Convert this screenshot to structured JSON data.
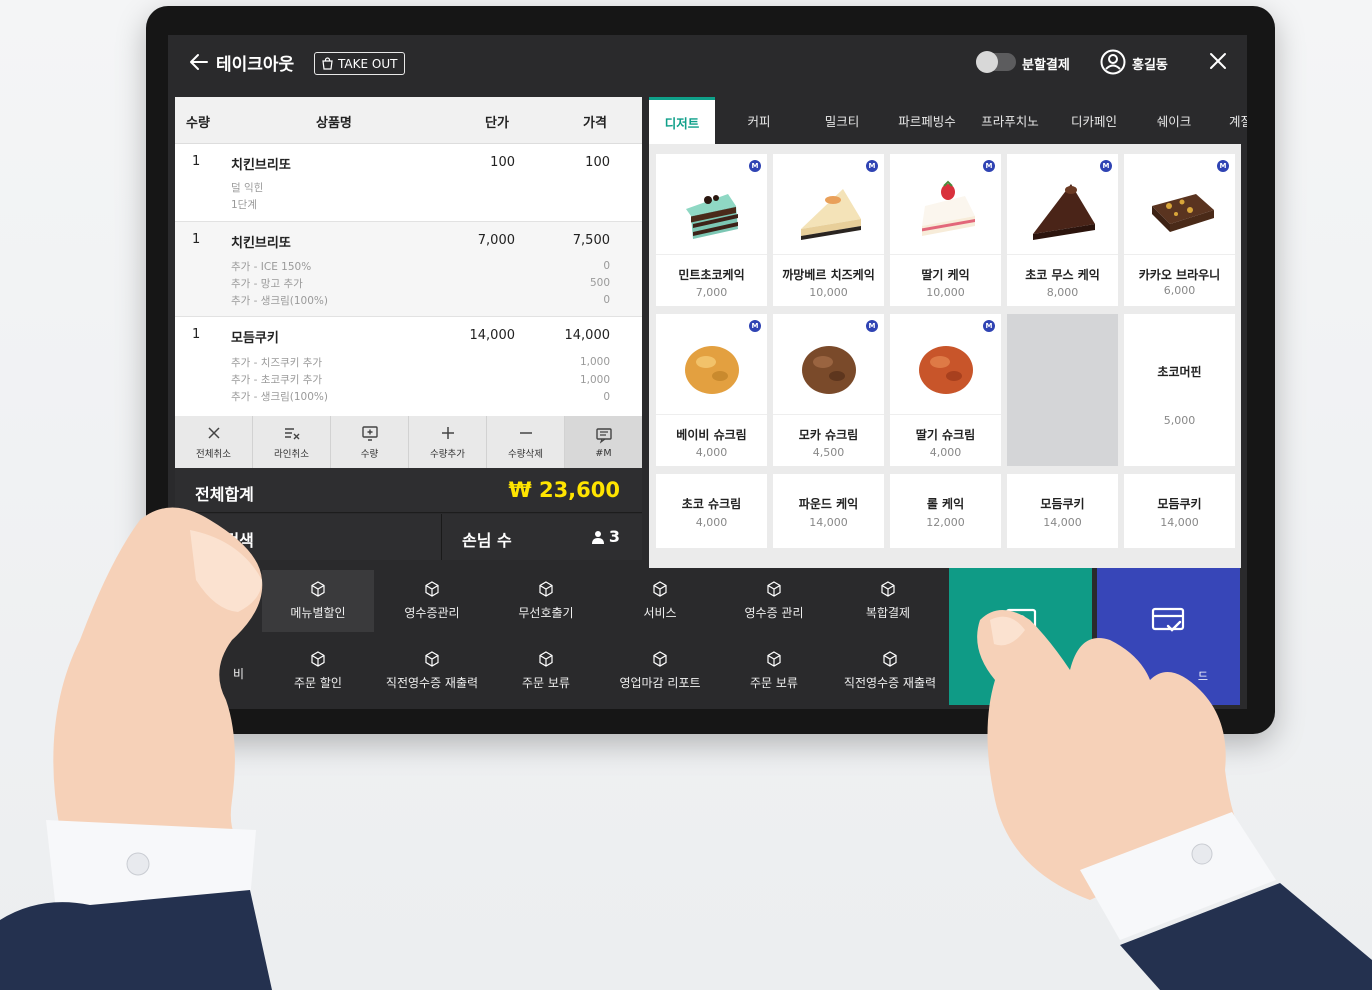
{
  "header": {
    "title": "테이크아웃",
    "takeout_badge": "TAKE OUT",
    "split_payment_label": "분할결제",
    "user_name": "홍길동"
  },
  "order_table": {
    "columns": [
      "수량",
      "상품명",
      "단가",
      "가격"
    ],
    "rows": [
      {
        "qty": "1",
        "name": "치킨브리또",
        "unit_price": "100",
        "price": "100",
        "options": [
          {
            "text": "덜 익힌",
            "price": ""
          },
          {
            "text": "1단계",
            "price": ""
          }
        ]
      },
      {
        "qty": "1",
        "name": "치킨브리또",
        "unit_price": "7,000",
        "price": "7,500",
        "options": [
          {
            "text": "추가 - ICE 150%",
            "price": "0"
          },
          {
            "text": "추가 - 망고 추가",
            "price": "500"
          },
          {
            "text": "추가 - 생크림(100%)",
            "price": "0"
          }
        ]
      },
      {
        "qty": "1",
        "name": "모듬쿠키",
        "unit_price": "14,000",
        "price": "14,000",
        "options": [
          {
            "text": "추가 - 치즈쿠키 추가",
            "price": "1,000"
          },
          {
            "text": "추가 - 초코쿠키 추가",
            "price": "1,000"
          },
          {
            "text": "추가 - 생크림(100%)",
            "price": "0"
          }
        ]
      }
    ]
  },
  "actions": [
    {
      "label": "전체취소",
      "icon": "x-icon"
    },
    {
      "label": "라인취소",
      "icon": "line-cancel-icon"
    },
    {
      "label": "수량",
      "icon": "quantity-icon"
    },
    {
      "label": "수량추가",
      "icon": "plus-icon"
    },
    {
      "label": "수량삭제",
      "icon": "minus-icon"
    },
    {
      "label": "#M",
      "icon": "memo-icon"
    }
  ],
  "totals": {
    "label": "전체합계",
    "value": "₩ 23,600",
    "member_search": "회원검색",
    "guest_label": "손님 수",
    "guest_count": "3"
  },
  "categories": [
    "디저트",
    "커피",
    "밀크티",
    "파르페빙수",
    "프라푸치노",
    "디카페인",
    "쉐이크",
    "계절"
  ],
  "active_category": "디저트",
  "products": [
    {
      "name": "민트초코케익",
      "price": "7,000",
      "badge": "M",
      "image": "mint-choco-cake"
    },
    {
      "name": "까망베르 치즈케익",
      "price": "10,000",
      "badge": "M",
      "image": "cheesecake"
    },
    {
      "name": "딸기 케익",
      "price": "10,000",
      "badge": "M",
      "image": "strawberry-cake"
    },
    {
      "name": "초코 무스 케익",
      "price": "8,000",
      "badge": "M",
      "image": "choco-mousse-cake"
    },
    {
      "name": "카카오 브라우니",
      "price": "6,000",
      "badge": "M",
      "image": "brownie"
    },
    {
      "name": "베이비 슈크림",
      "price": "4,000",
      "badge": "M",
      "image": "cream-puff"
    },
    {
      "name": "모카 슈크림",
      "price": "4,500",
      "badge": "M",
      "image": "mocha-puff"
    },
    {
      "name": "딸기 슈크림",
      "price": "4,000",
      "badge": "M",
      "image": "strawberry-puff"
    },
    {
      "name": "",
      "price": "",
      "badge": "",
      "image": ""
    },
    {
      "name": "초코머핀",
      "price": "5,000",
      "badge": "",
      "image": ""
    },
    {
      "name": "초코 슈크림",
      "price": "4,000",
      "badge": "",
      "image": ""
    },
    {
      "name": "파운드 케익",
      "price": "14,000",
      "badge": "",
      "image": ""
    },
    {
      "name": "롤 케익",
      "price": "12,000",
      "badge": "",
      "image": ""
    },
    {
      "name": "모듬쿠키",
      "price": "14,000",
      "badge": "",
      "image": ""
    },
    {
      "name": "모듬쿠키",
      "price": "14,000",
      "badge": "",
      "image": ""
    }
  ],
  "functions_row1": [
    "메뉴별할인",
    "영수증관리",
    "무선호출기",
    "서비스",
    "영수증 관리",
    "복합결제"
  ],
  "functions_row2": [
    "주문 할인",
    "직전영수증 재출력",
    "주문 보류",
    "영업마감 리포트",
    "주문 보류",
    "직전영수증 재출력"
  ],
  "functions_partial": "비",
  "payment": {
    "cash_icon": "cash-icon",
    "card_icon": "card-icon",
    "card_label_fragment": "드"
  },
  "colors": {
    "accent_teal": "#0fa08a",
    "card_blue": "#3746b8",
    "total_yellow": "#ffe400",
    "badge_blue": "#2f43b3"
  }
}
